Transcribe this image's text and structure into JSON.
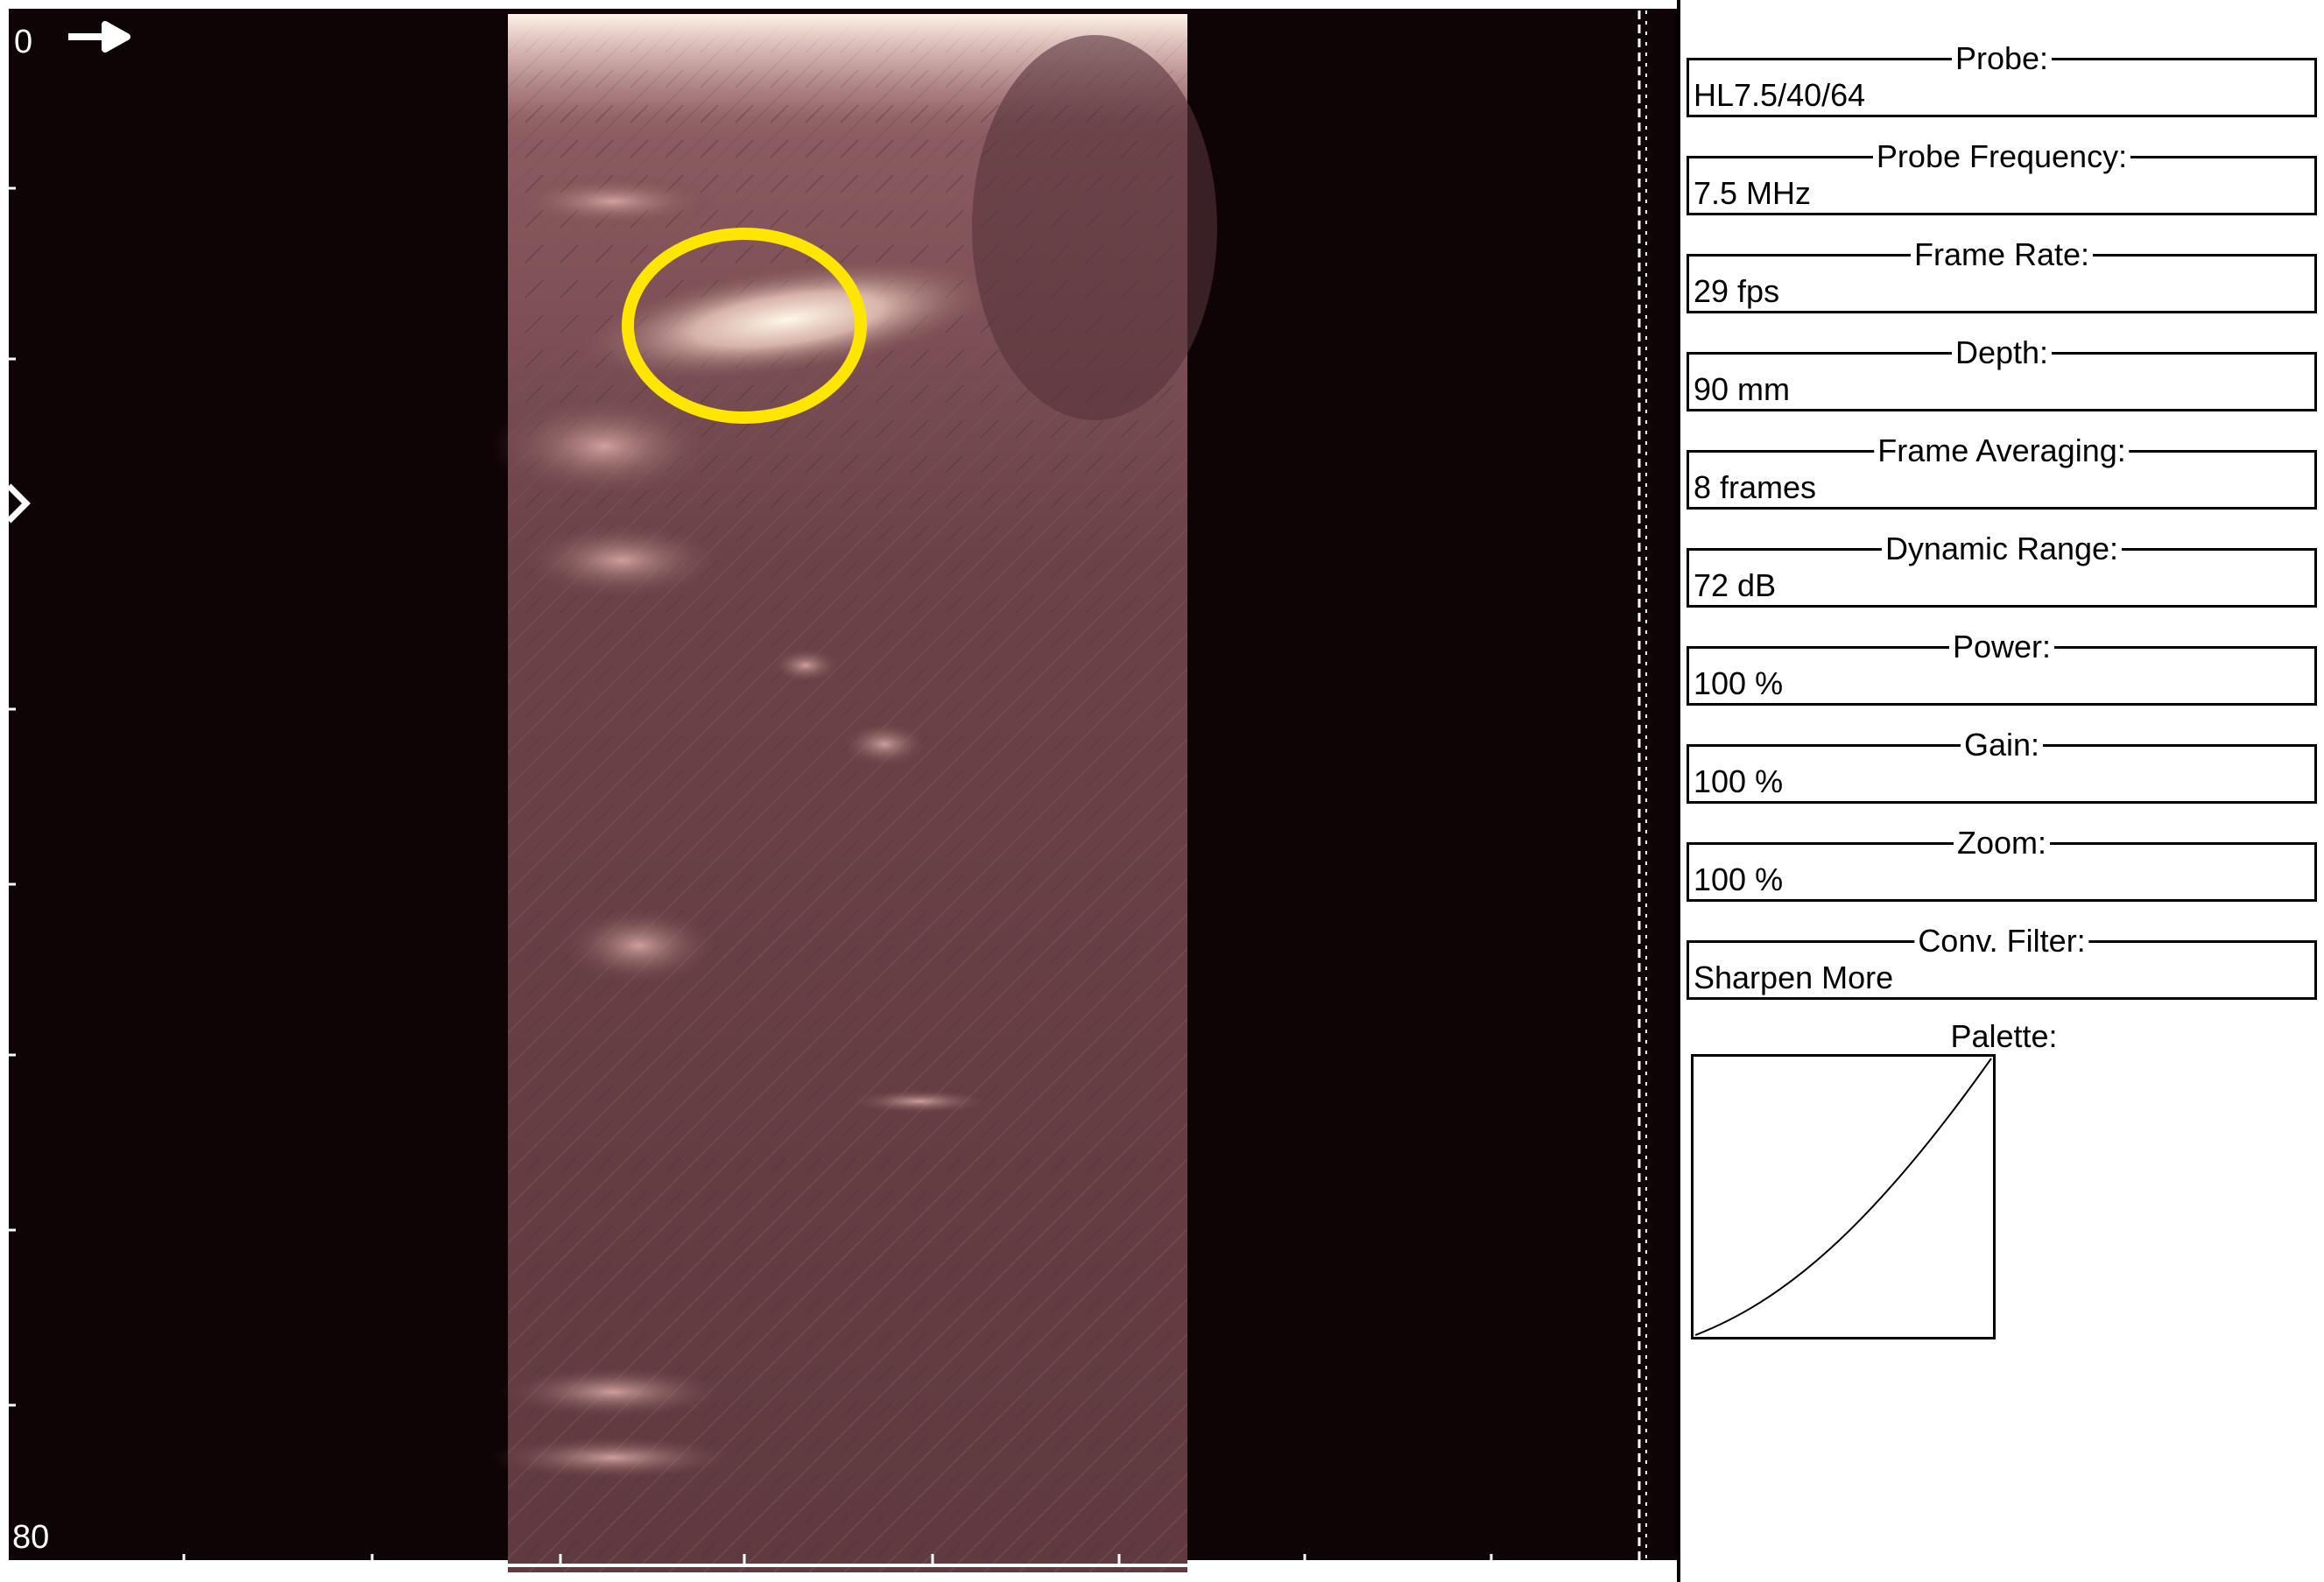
{
  "viewer": {
    "depth_top_label": "0",
    "depth_bottom_label": "80",
    "marker_colors": {
      "background": "#0e0305",
      "ultrasound_tint": "#6a4146",
      "highlight_ellipse": "#ffe600",
      "axis": "#ffffff"
    }
  },
  "panel": {
    "fields": [
      {
        "title": "Probe:",
        "value": "HL7.5/40/64"
      },
      {
        "title": "Probe Frequency:",
        "value": "7.5 MHz"
      },
      {
        "title": "Frame Rate:",
        "value": "29 fps"
      },
      {
        "title": "Depth:",
        "value": "90 mm"
      },
      {
        "title": "Frame Averaging:",
        "value": "8 frames"
      },
      {
        "title": "Dynamic Range:",
        "value": "72 dB"
      },
      {
        "title": "Power:",
        "value": "100 %"
      },
      {
        "title": "Gain:",
        "value": "100 %"
      },
      {
        "title": "Zoom:",
        "value": "100 %"
      },
      {
        "title": "Conv. Filter:",
        "value": "Sharpen More"
      }
    ],
    "palette_title": "Palette:"
  }
}
